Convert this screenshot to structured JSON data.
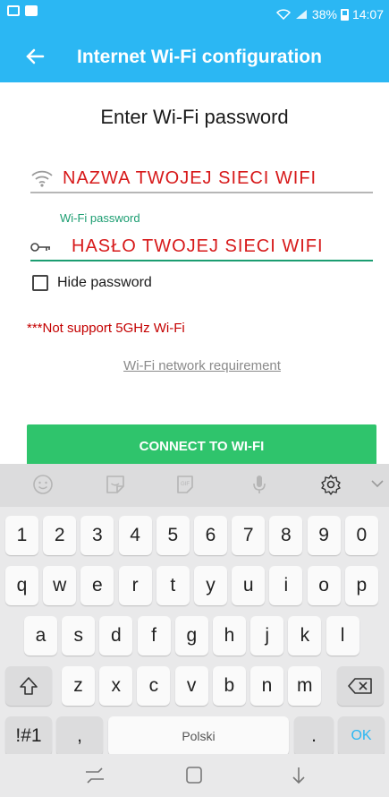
{
  "status_bar": {
    "battery": "38%",
    "time": "14:07"
  },
  "app_bar": {
    "title": "Internet Wi-Fi configuration"
  },
  "form": {
    "heading": "Enter Wi-Fi password",
    "ssid_value": "NAZWA TWOJEJ SIECI WIFI",
    "password_label": "Wi-Fi password",
    "password_value": "HASŁO TWOJEJ SIECI WIFI",
    "hide_password_label": "Hide password",
    "hide_password_checked": false,
    "warning": "***Not support 5GHz Wi-Fi",
    "requirement_link": "Wi-Fi network requirement",
    "connect_button": "CONNECT TO WI-FI"
  },
  "keyboard": {
    "toolbar_icons": [
      "emoji-icon",
      "sticker-icon",
      "gif-icon",
      "microphone-icon",
      "settings-icon",
      "collapse-icon"
    ],
    "row_numbers": [
      "1",
      "2",
      "3",
      "4",
      "5",
      "6",
      "7",
      "8",
      "9",
      "0"
    ],
    "row_1": [
      "q",
      "w",
      "e",
      "r",
      "t",
      "y",
      "u",
      "i",
      "o",
      "p"
    ],
    "row_2": [
      "a",
      "s",
      "d",
      "f",
      "g",
      "h",
      "j",
      "k",
      "l"
    ],
    "row_3": [
      "z",
      "x",
      "c",
      "v",
      "b",
      "n",
      "m"
    ],
    "symbols_key": "!#1",
    "comma_key": ",",
    "space_label": "Polski",
    "period_key": ".",
    "ok_key": "OK"
  },
  "colors": {
    "accent": "#2bb7f3",
    "connect": "#2fc46c",
    "warning": "#c40000",
    "input_text": "#d7191a",
    "focus_green": "#1b9d71"
  }
}
